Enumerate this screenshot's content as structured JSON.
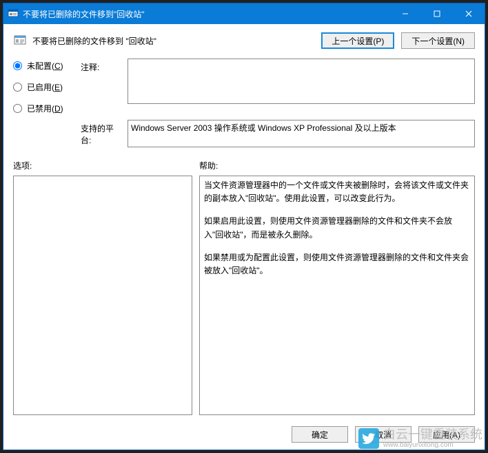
{
  "window": {
    "title": "不要将已删除的文件移到\"回收站\""
  },
  "header": {
    "policy_title": "不要将已删除的文件移到 \"回收站\"",
    "prev_label": "上一个设置(P)",
    "next_label": "下一个设置(N)"
  },
  "config": {
    "radios": {
      "not_configured": "未配置(C)",
      "enabled": "已启用(E)",
      "disabled": "已禁用(D)",
      "nc_hotkey": "C",
      "en_hotkey": "E",
      "dis_hotkey": "D",
      "selected": "not_configured"
    },
    "comment_label": "注释:",
    "comment_value": "",
    "platform_label": "支持的平台:",
    "platform_value": "Windows Server 2003 操作系统或 Windows XP Professional 及以上版本"
  },
  "lower": {
    "options_label": "选项:",
    "help_label": "帮助:",
    "help_paragraphs": [
      "当文件资源管理器中的一个文件或文件夹被删除时，会将该文件或文件夹的副本放入\"回收站\"。使用此设置，可以改变此行为。",
      "如果启用此设置，则使用文件资源管理器删除的文件和文件夹不会放入\"回收站\"，而是被永久删除。",
      "如果禁用或为配置此设置，则使用文件资源管理器删除的文件和文件夹会被放入\"回收站\"。"
    ]
  },
  "footer": {
    "ok": "确定",
    "cancel": "取消",
    "apply": "应用(A)"
  },
  "watermark": {
    "main": "白云一键重装系统",
    "sub": "www.baiyunxitong.com"
  }
}
